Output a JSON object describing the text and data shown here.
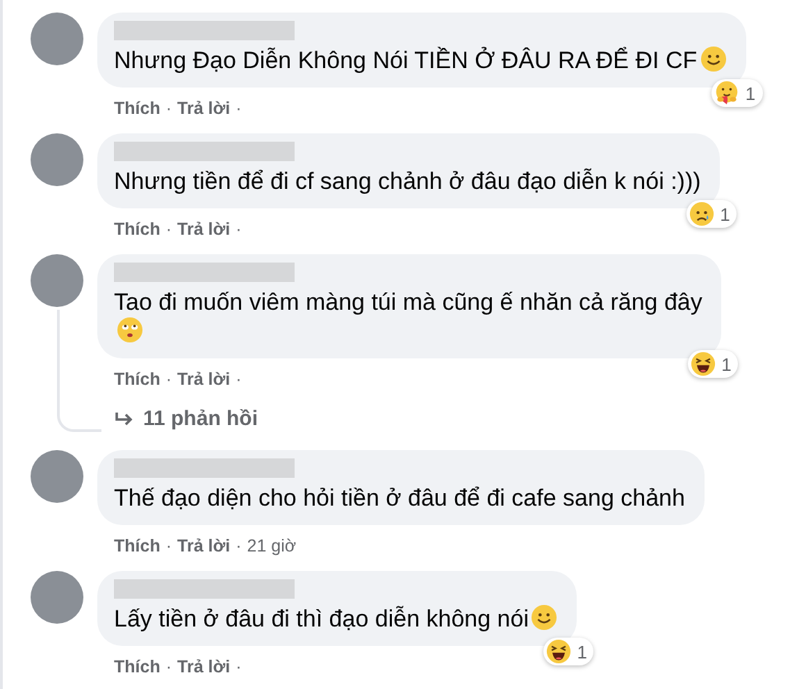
{
  "separator": "·",
  "comments": [
    {
      "text": "Nhưng Đạo Diễn Không Nói TIỀN Ở ĐÂU RA ĐỂ ĐI CF",
      "inline_emoji": {
        "kind": "smile"
      },
      "emoji_wraps": false,
      "reaction": {
        "kind": "care",
        "count": "1"
      },
      "actions": [
        "Thích",
        "Trả lời"
      ]
    },
    {
      "text": "Nhưng tiền để đi cf sang chảnh ở đâu đạo diễn k nói :)))",
      "reaction": {
        "kind": "sad",
        "count": "1"
      },
      "actions": [
        "Thích",
        "Trả lời"
      ]
    },
    {
      "text": "Tao đi muốn viêm màng túi mà cũng ế nhăn cả răng đây",
      "inline_emoji": {
        "kind": "rolling-eyes"
      },
      "emoji_wraps": true,
      "reaction": {
        "kind": "haha",
        "count": "1"
      },
      "actions": [
        "Thích",
        "Trả lời"
      ],
      "replies": "11 phản hồi"
    },
    {
      "text": "Thế đạo diện cho hỏi tiền ở đâu để đi cafe sang chảnh",
      "actions": [
        "Thích",
        "Trả lời"
      ],
      "time": "21 giờ"
    },
    {
      "text": "Lấy tiền ở đâu đi thì đạo diễn không nói",
      "inline_emoji": {
        "kind": "smile"
      },
      "emoji_wraps": false,
      "reaction": {
        "kind": "haha",
        "count": "1"
      },
      "actions": [
        "Thích",
        "Trả lời"
      ]
    }
  ]
}
